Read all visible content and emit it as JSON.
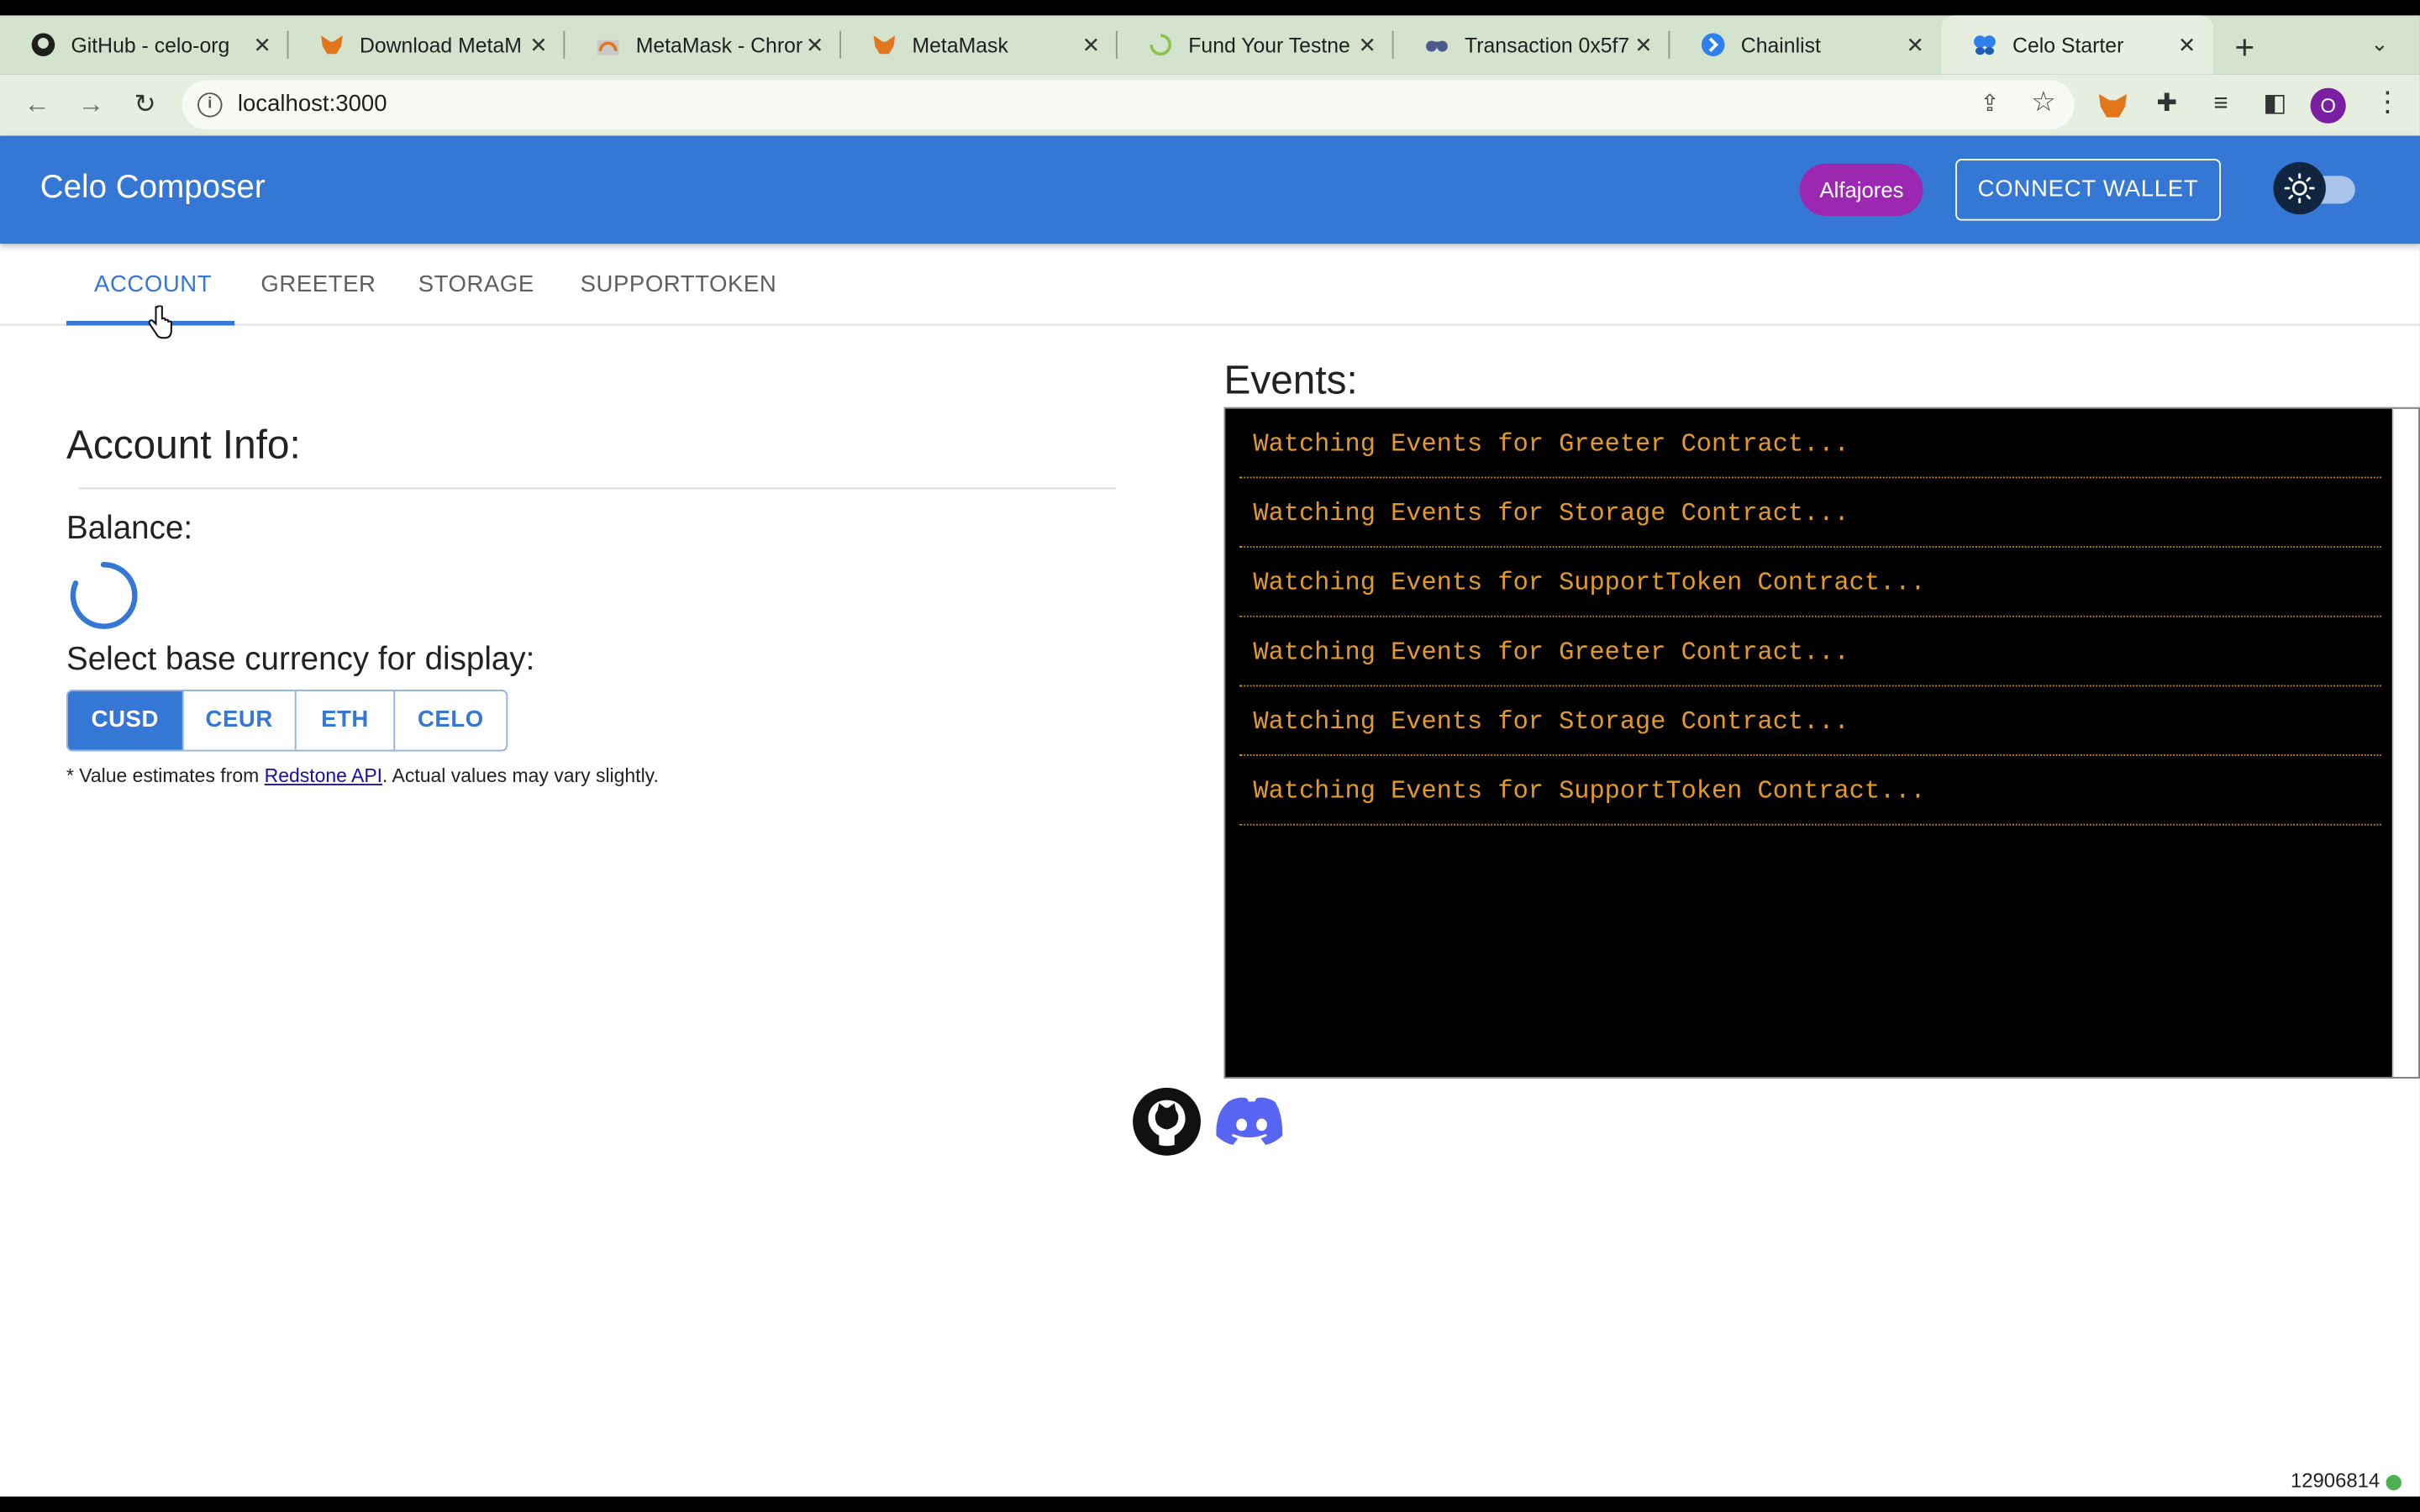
{
  "browser": {
    "tabs": [
      {
        "title": "GitHub - celo-org",
        "icon": "github-icon"
      },
      {
        "title": "Download MetaM",
        "icon": "metamask-icon"
      },
      {
        "title": "MetaMask - Chror",
        "icon": "chrome-store-icon"
      },
      {
        "title": "MetaMask",
        "icon": "metamask-icon"
      },
      {
        "title": "Fund Your Testne",
        "icon": "loading-icon"
      },
      {
        "title": "Transaction 0x5f7",
        "icon": "binoculars-icon"
      },
      {
        "title": "Chainlist",
        "icon": "chainlist-icon"
      },
      {
        "title": "Celo Starter",
        "icon": "butterfly-icon",
        "active": true
      }
    ],
    "url": "localhost:3000",
    "profile_initial": "O"
  },
  "app": {
    "title": "Celo Composer",
    "network": "Alfajores",
    "connect_label": "CONNECT WALLET"
  },
  "tabs": [
    "ACCOUNT",
    "GREETER",
    "STORAGE",
    "SUPPORTTOKEN"
  ],
  "account": {
    "title": "Account Info:",
    "balance_label": "Balance:",
    "currency_label": "Select base currency for display:",
    "currencies": [
      "CUSD",
      "CEUR",
      "ETH",
      "CELO"
    ],
    "selected_currency": "CUSD",
    "note_prefix": "* Value estimates from ",
    "note_link": "Redstone API",
    "note_suffix": ". Actual values may vary slightly."
  },
  "events": {
    "title": "Events:",
    "rows": [
      "Watching Events for Greeter Contract...",
      "Watching Events for Storage Contract...",
      "Watching Events for SupportToken Contract...",
      "Watching Events for Greeter Contract...",
      "Watching Events for Storage Contract...",
      "Watching Events for SupportToken Contract..."
    ]
  },
  "status": {
    "block_number": "12906814"
  },
  "colors": {
    "primary": "#3577d4",
    "network_chip": "#9c27b0",
    "event_text": "#e39a2c"
  }
}
